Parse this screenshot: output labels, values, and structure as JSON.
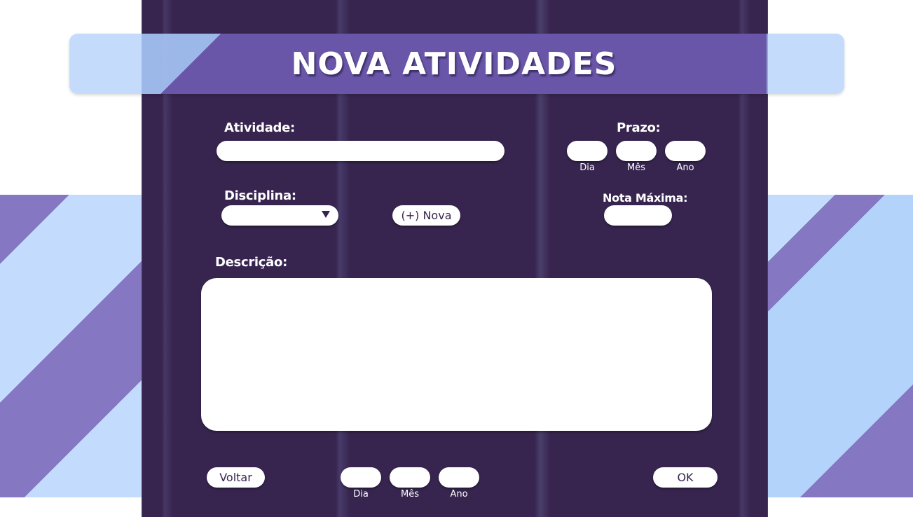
{
  "header": {
    "title": "NOVA ATIVIDADES"
  },
  "form": {
    "atividade_label": "Atividade:",
    "atividade_value": "",
    "prazo_label": "Prazo:",
    "prazo_dia_label": "Dia",
    "prazo_mes_label": "Mês",
    "prazo_ano_label": "Ano",
    "disciplina_label": "Disciplina:",
    "disciplina_selected": "",
    "nova_button": "(+) Nova",
    "nota_maxima_label": "Nota Máxima:",
    "descricao_label": "Descrição:",
    "descricao_value": ""
  },
  "footer": {
    "voltar_button": "Voltar",
    "dia_label": "Dia",
    "mes_label": "Mês",
    "ano_label": "Ano",
    "ok_button": "OK"
  },
  "colors": {
    "panel": "#37254f",
    "header_banner": "#6a56a8",
    "light_blue": "#c3dcfd",
    "stripe_purple": "#8577c2"
  }
}
